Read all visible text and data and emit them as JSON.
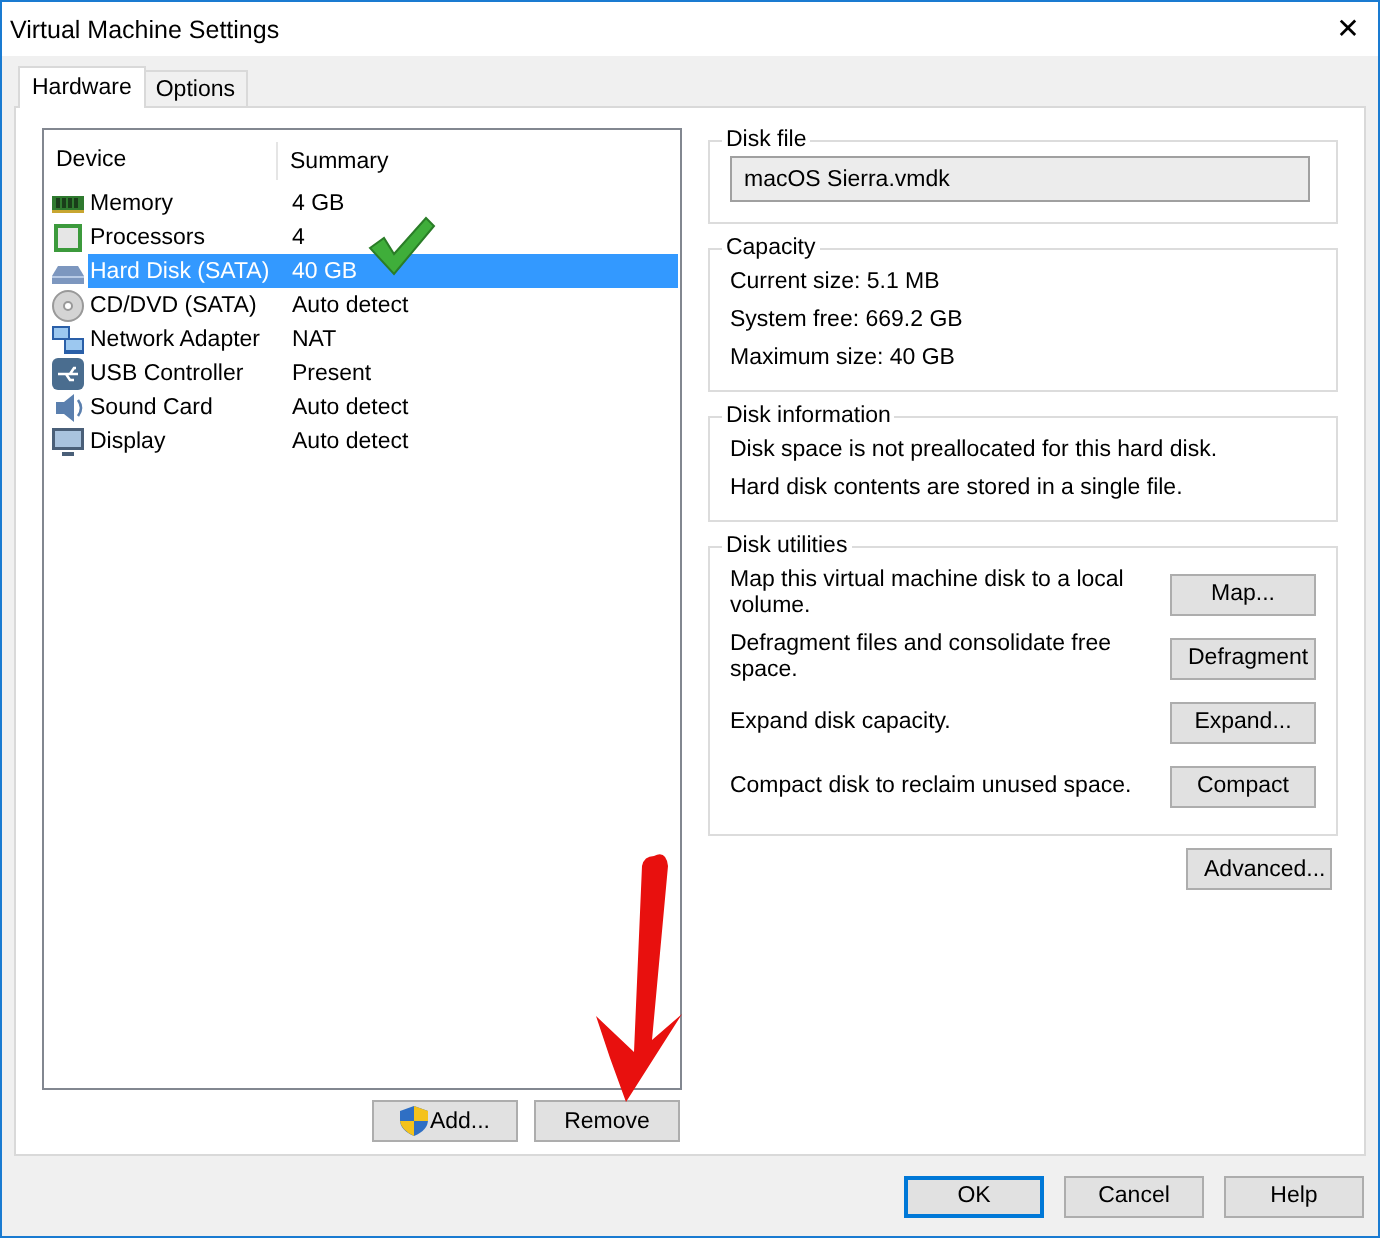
{
  "window": {
    "title": "Virtual Machine Settings",
    "close": "✕"
  },
  "tabs": [
    {
      "label": "Hardware",
      "selected": true
    },
    {
      "label": "Options",
      "selected": false
    }
  ],
  "device_list": {
    "columns": [
      "Device",
      "Summary"
    ],
    "rows": [
      {
        "kind": "memory",
        "device": "Memory",
        "summary": "4 GB",
        "selected": false
      },
      {
        "kind": "processor",
        "device": "Processors",
        "summary": "4",
        "selected": false
      },
      {
        "kind": "disk",
        "device": "Hard Disk (SATA)",
        "summary": "40 GB",
        "selected": true
      },
      {
        "kind": "cd",
        "device": "CD/DVD (SATA)",
        "summary": "Auto detect",
        "selected": false
      },
      {
        "kind": "network",
        "device": "Network Adapter",
        "summary": "NAT",
        "selected": false
      },
      {
        "kind": "usb",
        "device": "USB Controller",
        "summary": "Present",
        "selected": false
      },
      {
        "kind": "sound",
        "device": "Sound Card",
        "summary": "Auto detect",
        "selected": false
      },
      {
        "kind": "display",
        "device": "Display",
        "summary": "Auto detect",
        "selected": false
      }
    ]
  },
  "list_buttons": [
    {
      "label": "Add...",
      "shield": true
    },
    {
      "label": "Remove",
      "shield": false
    }
  ],
  "disk_file": {
    "title": "Disk file",
    "value": "macOS Sierra.vmdk"
  },
  "capacity": {
    "title": "Capacity",
    "lines": [
      "Current size:  5.1 MB",
      "System free:  669.2 GB",
      "Maximum size:  40 GB"
    ]
  },
  "disk_information": {
    "title": "Disk information",
    "lines": [
      "Disk space is not preallocated for this hard disk.",
      "Hard disk contents are stored in a single file."
    ]
  },
  "disk_utilities": {
    "title": "Disk utilities",
    "items": [
      {
        "text": "Map this virtual machine disk to a local volume.",
        "button": "Map..."
      },
      {
        "text": "Defragment files and consolidate free space.",
        "button": "Defragment"
      },
      {
        "text": "Expand disk capacity.",
        "button": "Expand..."
      },
      {
        "text": "Compact disk to reclaim unused space.",
        "button": "Compact"
      }
    ]
  },
  "advanced_button": "Advanced...",
  "footer_buttons": [
    {
      "label": "OK",
      "default": true
    },
    {
      "label": "Cancel",
      "default": false
    },
    {
      "label": "Help",
      "default": false
    }
  ]
}
